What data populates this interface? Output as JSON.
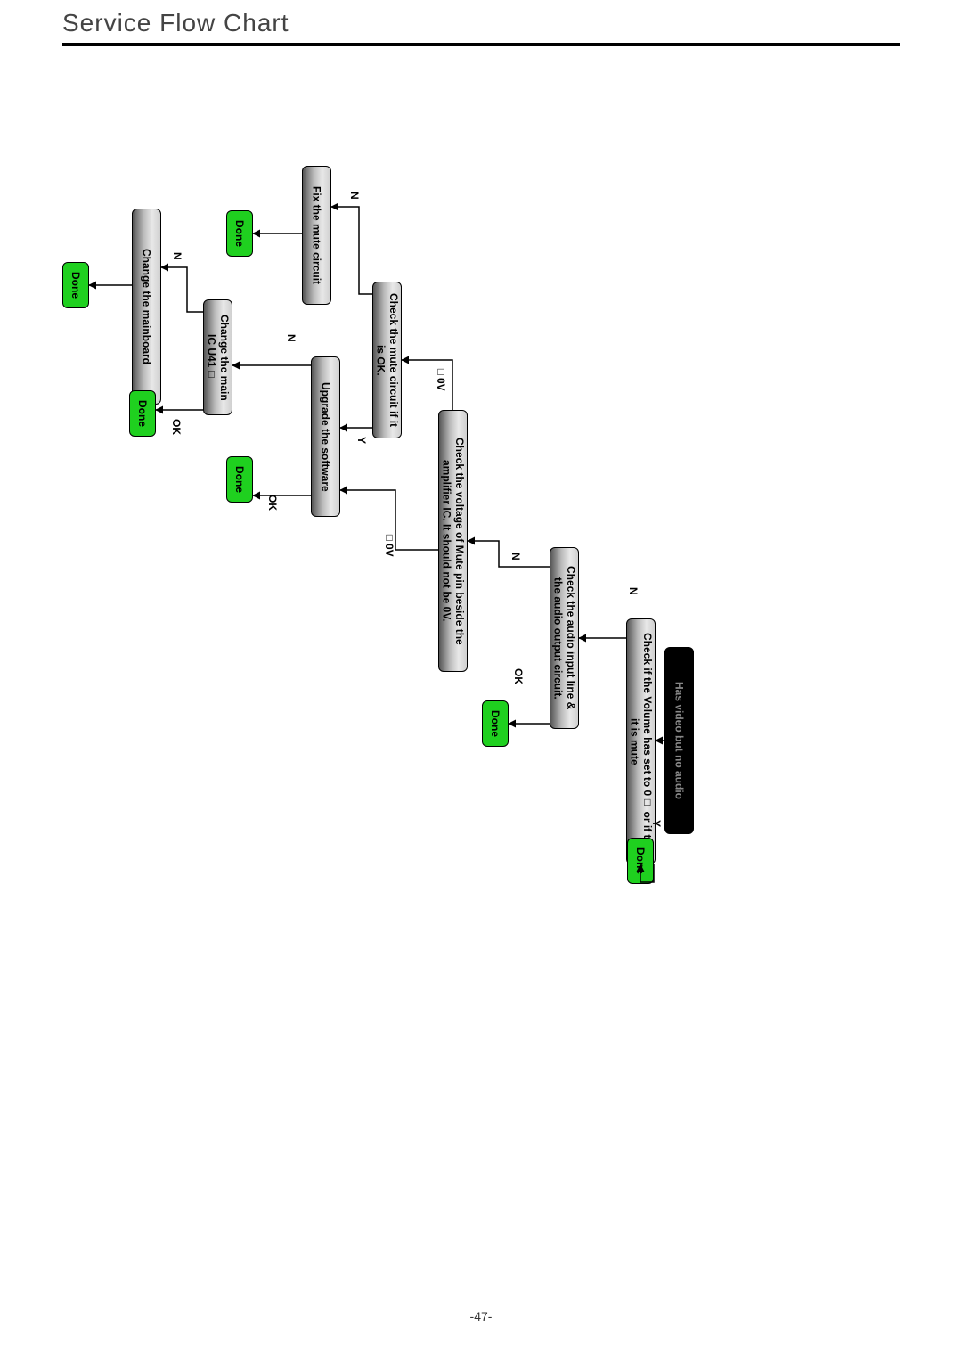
{
  "title": "Service Flow Chart",
  "page_number": "-47-",
  "chart_data": {
    "type": "flowchart",
    "title": "Service Flow Chart",
    "nodes": [
      {
        "id": "start",
        "kind": "start",
        "text": "Has video but no audio"
      },
      {
        "id": "check_volume",
        "kind": "process",
        "text": "Check if the Volume has set to 0□ or if the it is mute"
      },
      {
        "id": "done_volume",
        "kind": "done",
        "text": "Done"
      },
      {
        "id": "check_audio_line",
        "kind": "process",
        "text": "Check the audio input line & the audio output circuit."
      },
      {
        "id": "done_audio_line",
        "kind": "done",
        "text": "Done"
      },
      {
        "id": "check_mute_volt",
        "kind": "process",
        "text": "Check the voltage of Mute pin beside the amplifier IC. It should not be 0V."
      },
      {
        "id": "check_mute_ckt",
        "kind": "process",
        "text": "Check the mute circuit if it is OK."
      },
      {
        "id": "upgrade_sw",
        "kind": "process",
        "text": "Upgrade the software"
      },
      {
        "id": "done_sw",
        "kind": "done",
        "text": "Done"
      },
      {
        "id": "fix_mute_ckt",
        "kind": "process",
        "text": "Fix the mute circuit"
      },
      {
        "id": "done_fix_mute",
        "kind": "done",
        "text": "Done"
      },
      {
        "id": "change_ic",
        "kind": "process",
        "text": "Change the main IC U41□"
      },
      {
        "id": "change_mainboard",
        "kind": "process",
        "text": "Change the mainboard"
      },
      {
        "id": "done_ic",
        "kind": "done",
        "text": "Done"
      },
      {
        "id": "done_mainboard",
        "kind": "done",
        "text": "Done"
      }
    ],
    "edges": [
      {
        "from": "start",
        "to": "check_volume",
        "label": ""
      },
      {
        "from": "check_volume",
        "to": "done_volume",
        "label": "Y"
      },
      {
        "from": "check_volume",
        "to": "check_audio_line",
        "label": "N"
      },
      {
        "from": "check_audio_line",
        "to": "done_audio_line",
        "label": "OK"
      },
      {
        "from": "check_audio_line",
        "to": "check_mute_volt",
        "label": "N"
      },
      {
        "from": "check_mute_volt",
        "to": "check_mute_ckt",
        "label": "□0V"
      },
      {
        "from": "check_mute_volt",
        "to": "upgrade_sw",
        "label": "□0V"
      },
      {
        "from": "check_mute_ckt",
        "to": "upgrade_sw",
        "label": "Y"
      },
      {
        "from": "check_mute_ckt",
        "to": "fix_mute_ckt",
        "label": "N"
      },
      {
        "from": "upgrade_sw",
        "to": "done_sw",
        "label": "OK"
      },
      {
        "from": "upgrade_sw",
        "to": "change_ic",
        "label": "N"
      },
      {
        "from": "fix_mute_ckt",
        "to": "done_fix_mute",
        "label": ""
      },
      {
        "from": "change_ic",
        "to": "done_ic",
        "label": "OK"
      },
      {
        "from": "change_ic",
        "to": "change_mainboard",
        "label": "N"
      },
      {
        "from": "change_mainboard",
        "to": "done_mainboard",
        "label": ""
      }
    ]
  },
  "nodes": {
    "start": "Has video but no audio",
    "check_volume": "Check if the Volume has set to 0□ or if the it is mute",
    "done_volume": "Done",
    "check_audio_line": "Check the audio input line & the audio output circuit.",
    "done_audio_line": "Done",
    "check_mute_volt": "Check the voltage of Mute pin beside the amplifier IC. It should not be 0V.",
    "check_mute_ckt": "Check the mute circuit if it is OK.",
    "upgrade_sw": "Upgrade the software",
    "done_sw": "Done",
    "fix_mute_ckt": "Fix the mute circuit",
    "done_fix_mute": "Done",
    "change_ic": "Change the main IC U41□",
    "change_mainboard": "Change the mainboard",
    "done_ic": "Done",
    "done_mainboard": "Done"
  },
  "labels": {
    "Y": "Y",
    "N": "N",
    "OK": "OK",
    "zeroV": "□0V"
  }
}
